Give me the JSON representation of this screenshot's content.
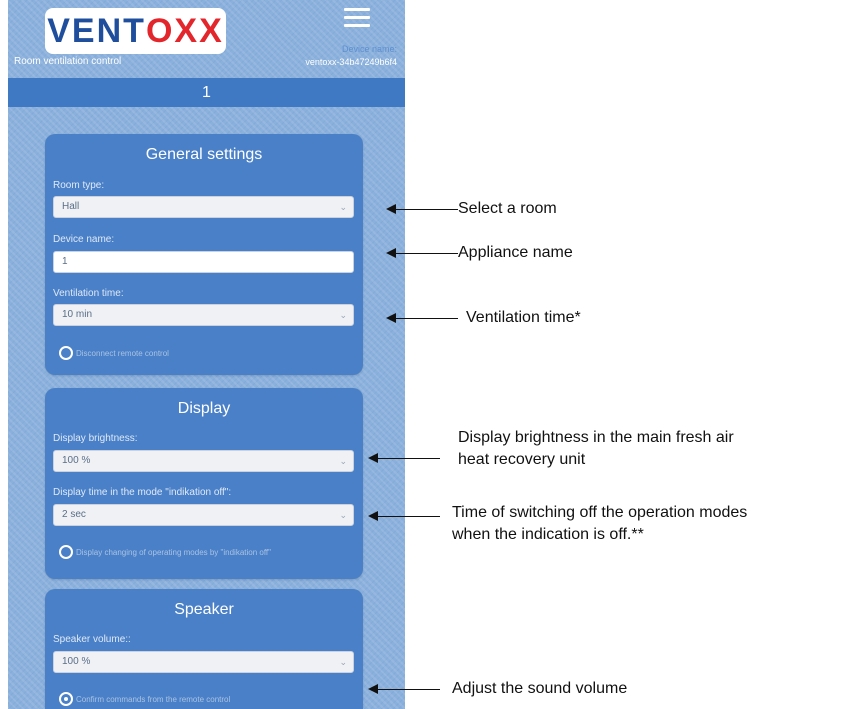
{
  "header": {
    "logo_main": "VENT",
    "logo_accent": "XX",
    "logo_mid": "O",
    "subtitle": "Room ventilation control",
    "device_name_label": "Device name:",
    "device_id": "ventoxx-34b47249b6f4",
    "menu_icon": "hamburger-menu-icon"
  },
  "title_bar": {
    "title": "1"
  },
  "general": {
    "title": "General settings",
    "room_type_label": "Room type:",
    "room_type_value": "Hall",
    "device_name_label": "Device name:",
    "device_name_value": "1",
    "ventilation_time_label": "Ventilation time:",
    "ventilation_time_value": "10 min",
    "disconnect_label": "Disconnect remote control"
  },
  "display": {
    "title": "Display",
    "brightness_label": "Display brightness:",
    "brightness_value": "100 %",
    "display_time_label": "Display time in the mode \"indikation off\":",
    "display_time_value": "2 sec",
    "display_changing_label": "Display changing of operating modes by \"indikation off\""
  },
  "speaker": {
    "title": "Speaker",
    "volume_label": "Speaker volume::",
    "volume_value": "100 %",
    "confirm_label": "Confirm commands from the remote control"
  },
  "annotations": {
    "select_room": "Select a room",
    "appliance_name": "Appliance name",
    "ventilation_time": "Ventilation time*",
    "brightness_line1": "Display brightness in the main fresh air",
    "brightness_line2": "heat recovery unit",
    "switching_line1": "Time of switching off the operation modes",
    "switching_line2": "when the indication is off.**",
    "sound_volume": "Adjust the sound volume"
  },
  "colors": {
    "background": "#8ab0dc",
    "card": "#4a80c8",
    "title_bar": "#3f78c3",
    "logo_blue": "#1f4f9c",
    "logo_red": "#e2262b"
  }
}
